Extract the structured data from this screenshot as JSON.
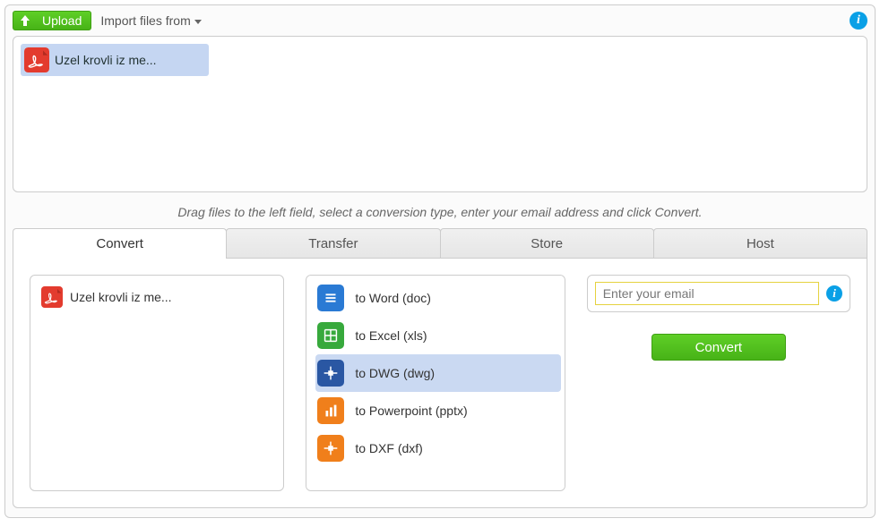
{
  "toolbar": {
    "upload_label": "Upload",
    "import_label": "Import files from"
  },
  "file": {
    "name": "Uzel krovli iz me...",
    "icon_name": "pdf-file-icon"
  },
  "hint": "Drag files to the left field, select a conversion type, enter your email address and click Convert.",
  "tabs": [
    {
      "label": "Convert",
      "active": true
    },
    {
      "label": "Transfer",
      "active": false
    },
    {
      "label": "Store",
      "active": false
    },
    {
      "label": "Host",
      "active": false
    }
  ],
  "formats": [
    {
      "label": "to Word (doc)",
      "icon": "word-icon",
      "color": "#2a7ad4",
      "selected": false
    },
    {
      "label": "to Excel (xls)",
      "icon": "excel-icon",
      "color": "#37a93c",
      "selected": false
    },
    {
      "label": "to DWG (dwg)",
      "icon": "dwg-icon",
      "color": "#2a57a3",
      "selected": true
    },
    {
      "label": "to Powerpoint (pptx)",
      "icon": "pptx-icon",
      "color": "#f07f1b",
      "selected": false
    },
    {
      "label": "to DXF (dxf)",
      "icon": "dxf-icon",
      "color": "#f07f1b",
      "selected": false
    }
  ],
  "email": {
    "placeholder": "Enter your email",
    "value": ""
  },
  "convert_button": "Convert"
}
